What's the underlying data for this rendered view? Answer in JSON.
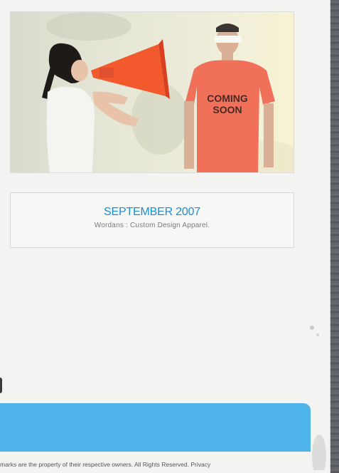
{
  "hero_image": {
    "shirt_text_line1": "COMING",
    "shirt_text_line2": "SOON"
  },
  "caption": {
    "title": "SEPTEMBER 2007",
    "subtitle": "Wordans : Custom Design Apparel."
  },
  "footer": {
    "legal_text": "marks are the property of their respective owners. All Rights Reserved.",
    "privacy_link": "Privacy"
  },
  "colors": {
    "accent_blue": "#1a8fd0",
    "footer_bar": "#4fb4ea",
    "cone_orange": "#f25a2e",
    "shirt_red": "#f0705a"
  }
}
